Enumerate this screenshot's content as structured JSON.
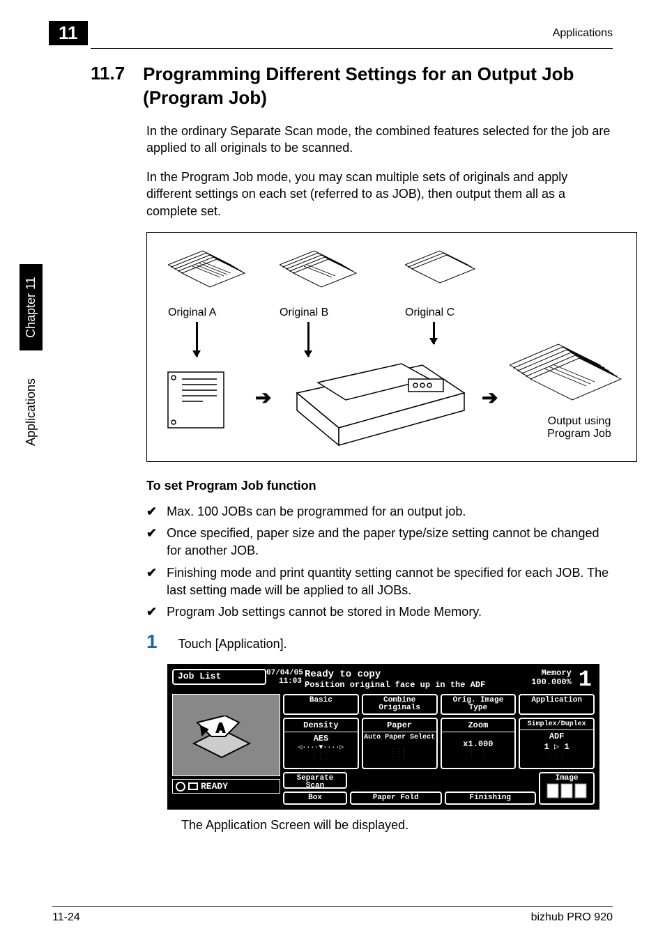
{
  "header": {
    "chapter_number": "11",
    "header_label": "Applications"
  },
  "section": {
    "number": "11.7",
    "title": "Programming Different Settings for an Output Job (Program Job)"
  },
  "intro_para_1": "In the ordinary Separate Scan mode, the combined features selected for the job are applied to all originals to be scanned.",
  "intro_para_2": "In the Program Job mode, you may scan multiple sets of originals and apply different settings on each set (referred to as JOB), then output them all as a complete set.",
  "diagram": {
    "original_a": "Original A",
    "original_b": "Original B",
    "original_c": "Original C",
    "output_line1": "Output using",
    "output_line2": "Program Job"
  },
  "subheading": "To set Program Job function",
  "checks": {
    "item1": "Max. 100 JOBs can be programmed for an output job.",
    "item2": "Once specified, paper size and the paper type/size setting cannot be changed for another JOB.",
    "item3": "Finishing mode and print quantity setting cannot be specified for each JOB. The last setting made will be applied to all JOBs.",
    "item4": "Program Job settings cannot be stored in Mode Memory."
  },
  "step": {
    "number": "1",
    "text": "Touch [Application]."
  },
  "screen": {
    "joblist": "Job List",
    "date": "07/04/05",
    "time": "11:03",
    "status_line1": "Ready to copy",
    "status_line2": "Position original face up in the ADF",
    "memory_label": "Memory",
    "memory_value": "100.000%",
    "count": "1",
    "tabs": {
      "basic": "Basic",
      "combine": "Combine Originals",
      "orig": "Orig. Image Type",
      "appli": "Application"
    },
    "settings": {
      "density_label": "Density",
      "density_value": "AES",
      "paper_label": "Paper",
      "paper_value": "Auto Paper Select",
      "zoom_label": "Zoom",
      "zoom_value": "x1.000",
      "simplex_label": "Simplex/Duplex",
      "simplex_value1": "ADF",
      "simplex_value2": "1 ▷ 1"
    },
    "bottom": {
      "separate": "Separate Scan",
      "box": "Box",
      "paperfold": "Paper Fold",
      "finishing": "Finishing",
      "image": "Image"
    },
    "ready": "READY"
  },
  "result_text": "The Application Screen will be displayed.",
  "sidebar": {
    "chapter": "Chapter 11",
    "label": "Applications"
  },
  "footer": {
    "page": "11-24",
    "product": "bizhub PRO 920"
  }
}
